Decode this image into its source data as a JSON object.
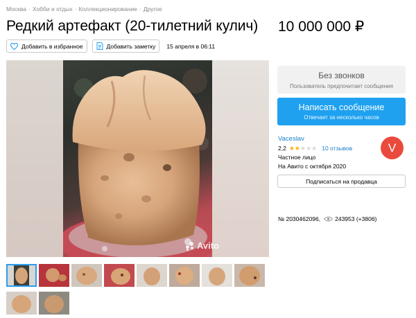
{
  "breadcrumbs": [
    "Москва",
    "Хобби и отдых",
    "Коллекционирование",
    "Другое"
  ],
  "breadcrumb_separator": "·",
  "listing": {
    "title": "Редкий артефакт (20-тилетний кулич)",
    "price": "10 000 000 ₽",
    "date": "15 апреля в 06:11"
  },
  "actions": {
    "favorite_label": "Добавить в избранное",
    "note_label": "Добавить заметку"
  },
  "gallery": {
    "watermark": "Avito",
    "thumbnail_count": 10,
    "selected_thumbnail": 1
  },
  "contact": {
    "no_calls_title": "Без звонков",
    "no_calls_subtitle": "Пользователь предпочитает сообщения",
    "write_title": "Написать сообщение",
    "write_subtitle": "Отвечает за несколько часов"
  },
  "seller": {
    "name": "Vaceslav",
    "rating": "2,2",
    "rating_stars": 2.2,
    "reviews": "10 отзывов",
    "type": "Частное лицо",
    "since": "На Авито с октября 2020",
    "avatar_letter": "V",
    "subscribe_label": "Подписаться на продавца"
  },
  "stats": {
    "number": "№ 2030462096,",
    "views": "243953 (+3806)"
  },
  "colors": {
    "accent_blue": "#1fa1f0",
    "link_blue": "#1a7fc9",
    "avatar_red": "#ea4a3e",
    "star_gold": "#f7b500"
  },
  "icons": [
    "heart-icon",
    "note-icon",
    "eye-icon",
    "avito-logo-icon",
    "star-icon"
  ]
}
